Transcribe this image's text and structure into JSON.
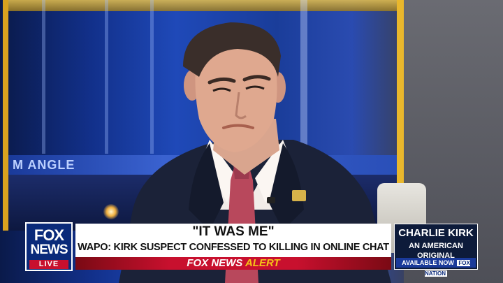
{
  "studio": {
    "wall_text": "M ANGLE"
  },
  "lower_third": {
    "logo": {
      "line1": "FOX",
      "line2": "NEWS",
      "live": "LIVE"
    },
    "headline": "\"IT WAS ME\"",
    "subheadline": "WAPO: KIRK SUSPECT CONFESSED TO KILLING IN ONLINE CHAT",
    "alert": {
      "brand": "FOX NEWS",
      "word": "ALERT"
    },
    "promo": {
      "title": "CHARLIE KIRK",
      "subtitle": "AN AMERICAN ORIGINAL",
      "availability": "AVAILABLE NOW",
      "service": "FOX NATION"
    }
  },
  "colors": {
    "fox_blue": "#0a2a7a",
    "alert_red": "#c8102e",
    "alert_yellow": "#f5c518",
    "frame_gold": "#e9b72c"
  }
}
